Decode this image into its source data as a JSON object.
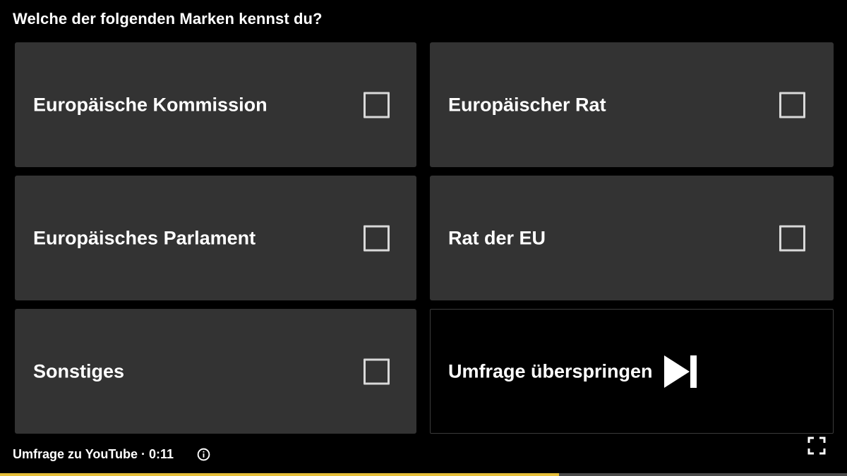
{
  "survey": {
    "question": "Welche der folgenden Marken kennst du?",
    "options": [
      {
        "label": "Europäische Kommission",
        "checked": false
      },
      {
        "label": "Europäischer Rat",
        "checked": false
      },
      {
        "label": "Europäisches Parlament",
        "checked": false
      },
      {
        "label": "Rat der EU",
        "checked": false
      },
      {
        "label": "Sonstiges",
        "checked": false
      }
    ],
    "skip_label": "Umfrage überspringen"
  },
  "footer": {
    "text": "Umfrage zu YouTube · 0:11",
    "info_icon": "info-icon",
    "fullscreen_icon": "fullscreen-icon"
  },
  "progress": {
    "fraction": 0.66,
    "fill_color": "#e6bf3a"
  },
  "colors": {
    "background": "#000000",
    "option_background": "#333333",
    "text": "#ffffff"
  }
}
